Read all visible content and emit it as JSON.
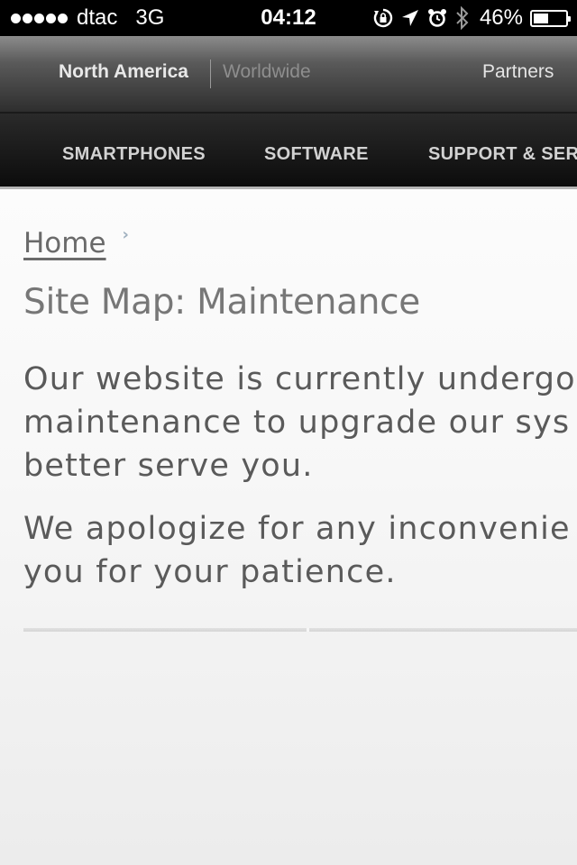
{
  "status_bar": {
    "carrier": "dtac",
    "network": "3G",
    "time": "04:12",
    "battery_percent_label": "46%",
    "battery_level": 0.46,
    "icons": [
      "signal-dots",
      "rotation-lock-icon",
      "location-arrow-icon",
      "alarm-icon",
      "bluetooth-icon",
      "battery-icon"
    ]
  },
  "header": {
    "region_current": "North America",
    "region_other": "Worldwide",
    "partners_label": "Partners",
    "nav": [
      "SMARTPHONES",
      "SOFTWARE",
      "SUPPORT & SERV"
    ]
  },
  "content": {
    "breadcrumb_home": "Home",
    "breadcrumb_separator_icon": "chevron-right-icon",
    "title": "Site Map: Maintenance",
    "paragraph_1": "Our website is currently undergo maintenance to upgrade our sys better serve you.",
    "paragraph_1_lines": [
      "Our website is currently undergo",
      "maintenance to upgrade our sys",
      "better serve you."
    ],
    "paragraph_2_lines": [
      "We apologize for any inconvenie",
      "you for your patience."
    ]
  },
  "colors": {
    "status_bar_bg": "#000000",
    "nav_bg": "#0c0c0c",
    "text_gray": "#5a5a5a",
    "title_gray": "#777777"
  }
}
